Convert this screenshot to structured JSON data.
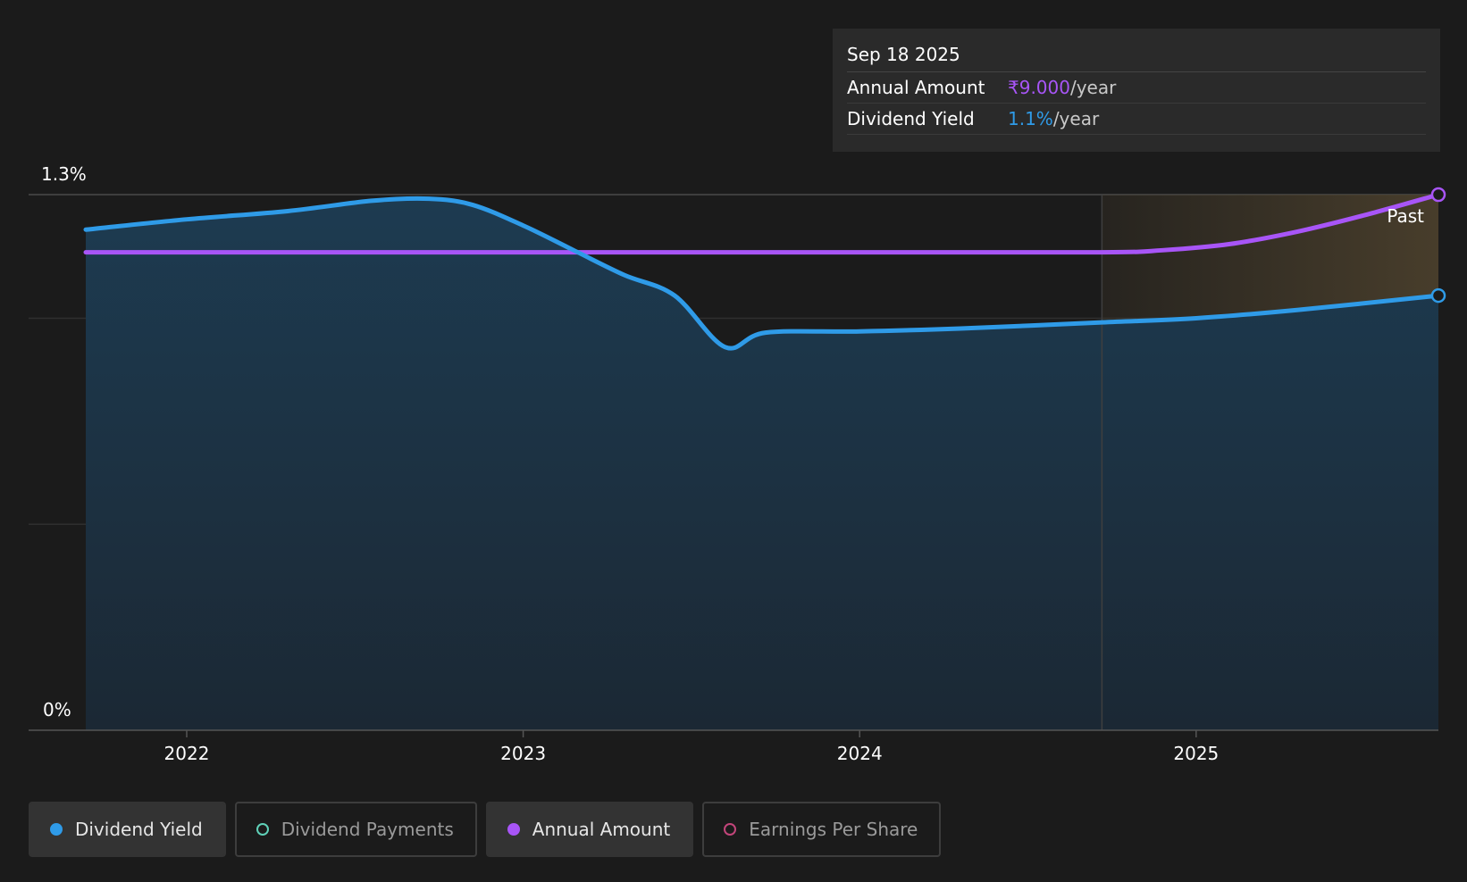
{
  "tooltip": {
    "date": "Sep 18 2025",
    "rows": [
      {
        "label": "Annual Amount",
        "value": "₹9.000",
        "unit": "/year"
      },
      {
        "label": "Dividend Yield",
        "value": "1.1%",
        "unit": "/year"
      }
    ]
  },
  "legend": [
    {
      "label": "Dividend Yield",
      "state": "active",
      "color": "#2f9be8"
    },
    {
      "label": "Dividend Payments",
      "state": "inactive",
      "color": "#5fd1b8"
    },
    {
      "label": "Annual Amount",
      "state": "active",
      "color": "#a855f7"
    },
    {
      "label": "Earnings Per Share",
      "state": "inactive",
      "color": "#c2457a"
    }
  ],
  "chart_data": {
    "type": "line",
    "y_tick_labels": [
      "1.3%",
      "0%"
    ],
    "ylim": [
      0,
      1.3
    ],
    "x_tick_labels": [
      "2022",
      "2023",
      "2024",
      "2025"
    ],
    "xlim": [
      2021.7,
      2025.72
    ],
    "past_label": "Past",
    "past_region_start": 2024.72,
    "colors": {
      "yield": "#2f9be8",
      "annual": "#a855f7",
      "past_bg": "#4a3f2c"
    },
    "series": [
      {
        "name": "Dividend Yield",
        "x": [
          2021.7,
          2022.0,
          2022.3,
          2022.55,
          2022.72,
          2022.85,
          2023.0,
          2023.15,
          2023.3,
          2023.45,
          2023.6,
          2023.72,
          2024.0,
          2024.3,
          2024.72,
          2025.0,
          2025.3,
          2025.72
        ],
        "values": [
          1.215,
          1.24,
          1.26,
          1.285,
          1.29,
          1.275,
          1.225,
          1.165,
          1.105,
          1.055,
          0.93,
          0.965,
          0.968,
          0.975,
          0.99,
          1.0,
          1.02,
          1.055
        ]
      },
      {
        "name": "Annual Amount",
        "x": [
          2021.7,
          2022.0,
          2023.0,
          2024.0,
          2024.72,
          2024.9,
          2025.1,
          2025.3,
          2025.5,
          2025.72
        ],
        "values": [
          1.16,
          1.16,
          1.16,
          1.16,
          1.16,
          1.165,
          1.18,
          1.21,
          1.25,
          1.3
        ]
      }
    ]
  }
}
